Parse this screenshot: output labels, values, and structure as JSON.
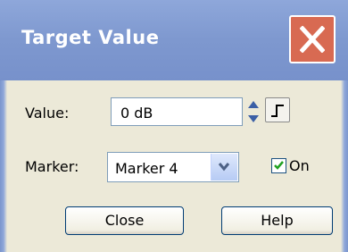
{
  "window": {
    "title": "Target Value"
  },
  "form": {
    "value_label": "Value:",
    "value": "0 dB",
    "marker_label": "Marker:",
    "marker_selected": "Marker 4",
    "on_label": "On",
    "on_checked": true
  },
  "buttons": {
    "close_label": "Close",
    "help_label": "Help"
  },
  "colors": {
    "titlebar": "#7e98cf",
    "close_button": "#d86a52",
    "dialog_body": "#ece9d8",
    "checkmark": "#21a121"
  }
}
